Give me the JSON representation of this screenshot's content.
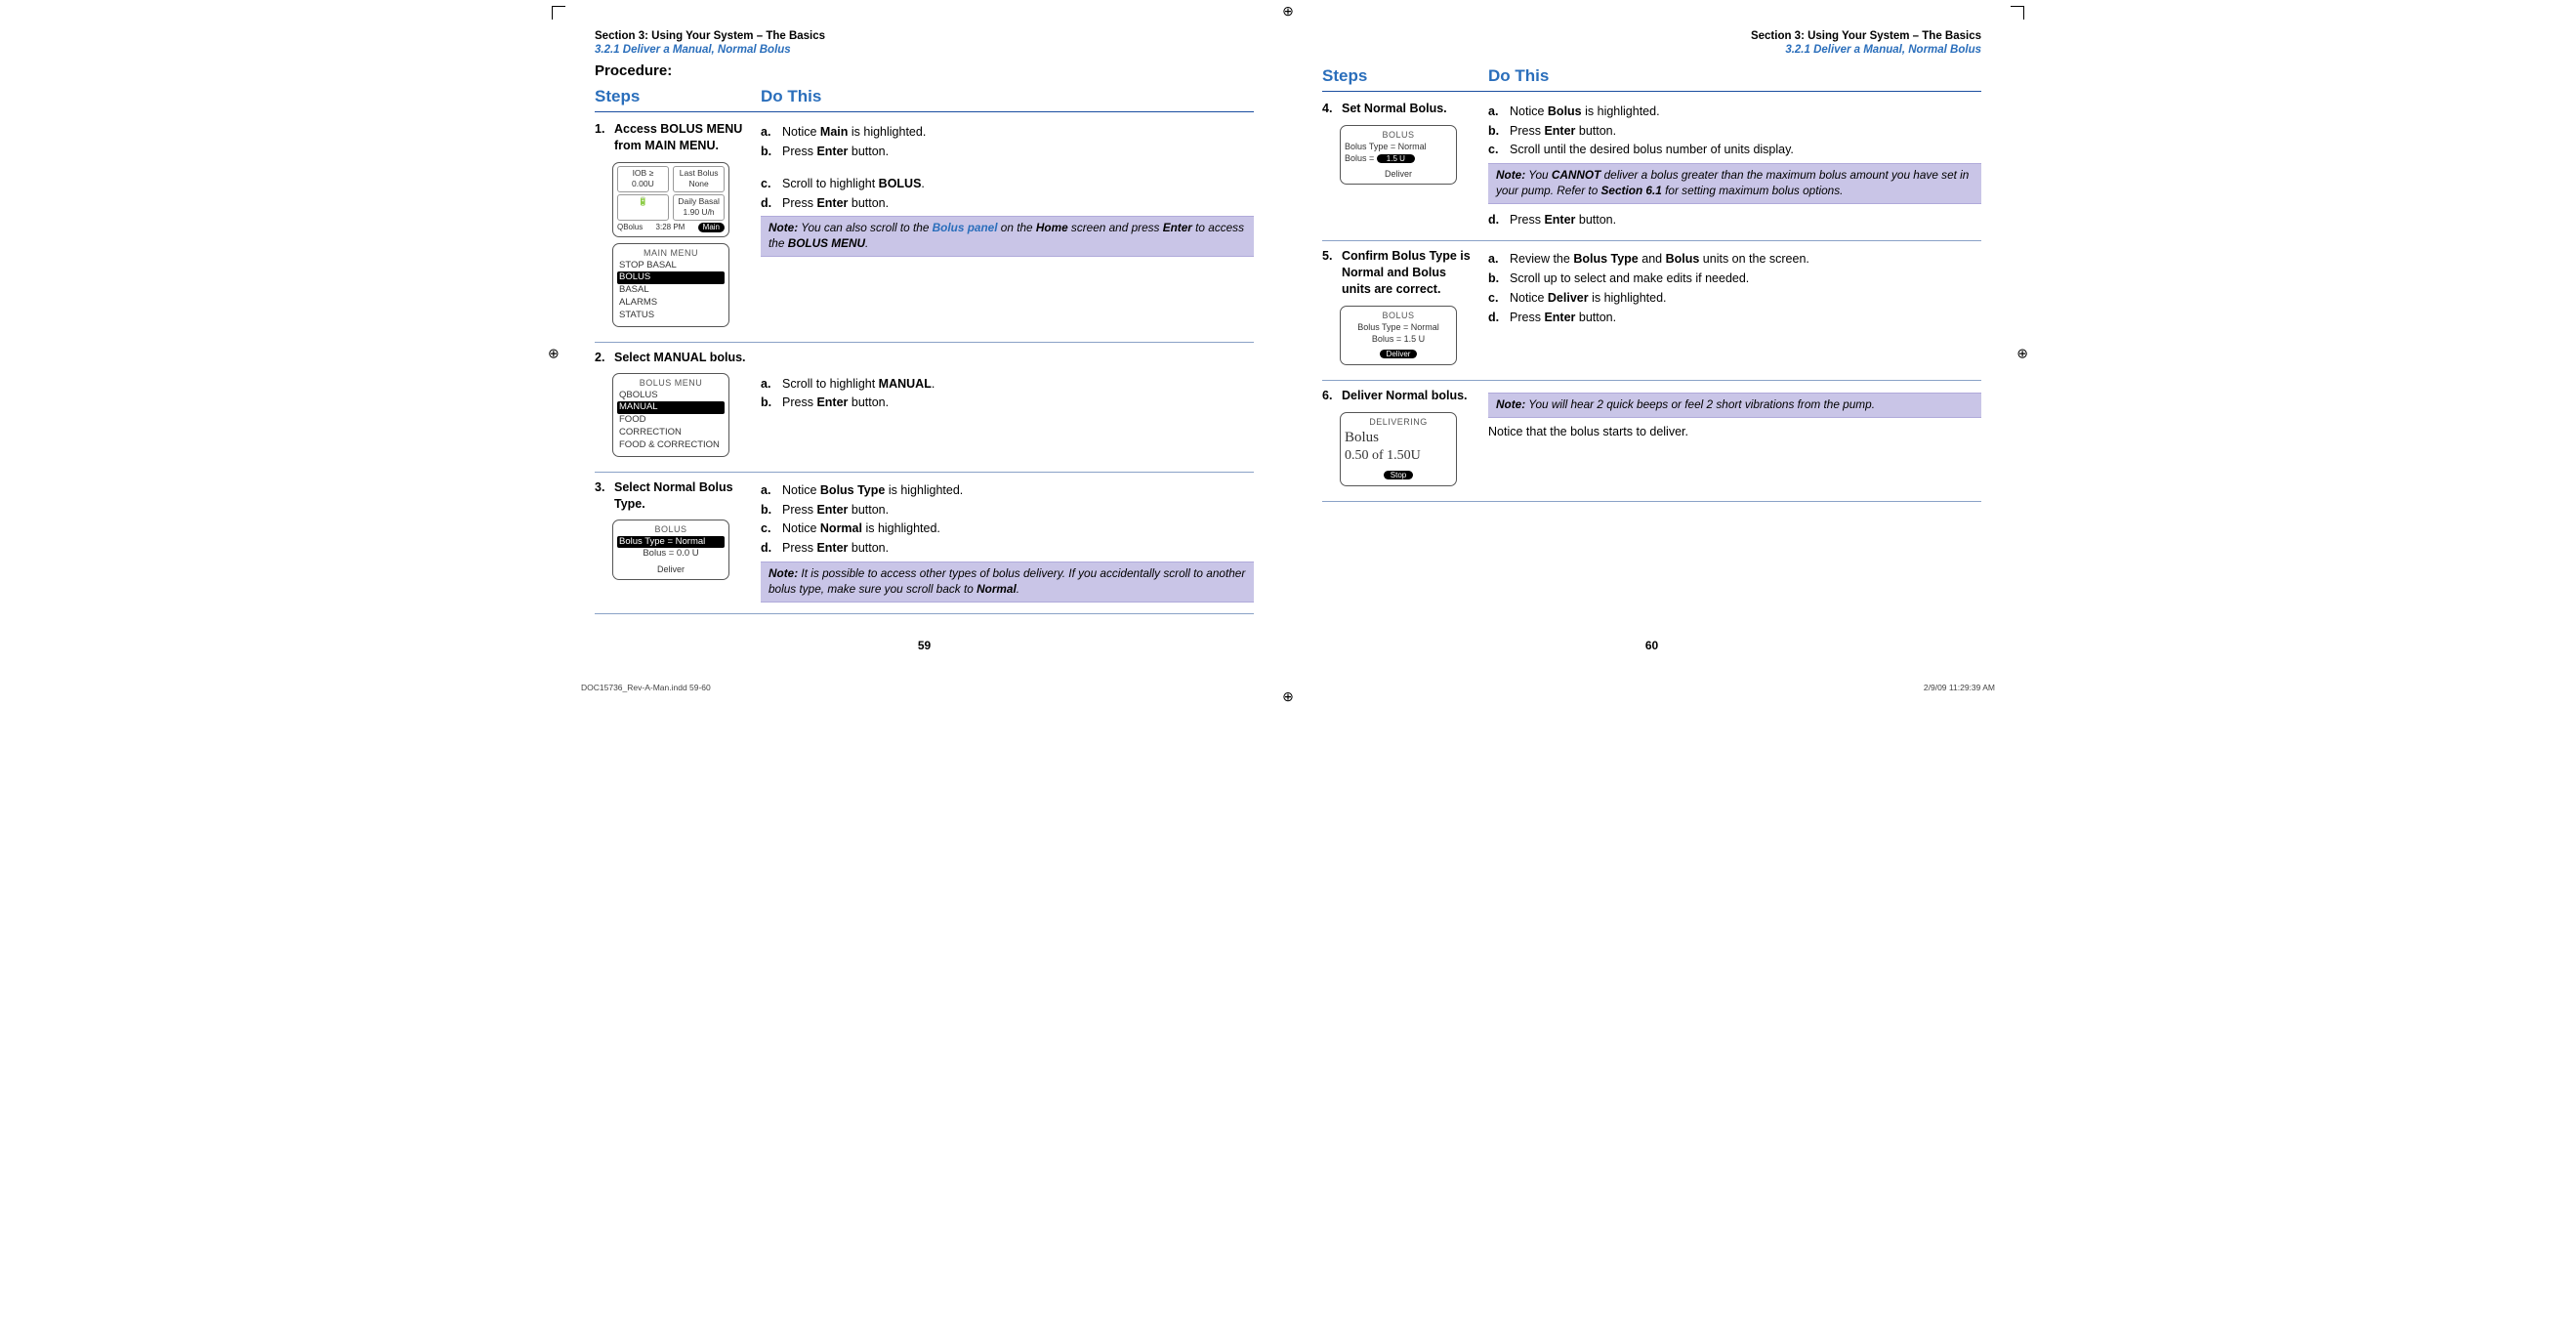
{
  "reg_mark": "⊕",
  "header": {
    "section_line": "Section 3: Using Your System – The Basics",
    "subsection_line": "3.2.1 Deliver a Manual, Normal Bolus"
  },
  "left_page": {
    "procedure_label": "Procedure:",
    "columns": {
      "steps": "Steps",
      "do_this": "Do This"
    },
    "steps": [
      {
        "num": "1.",
        "title_parts": [
          "Access ",
          "BOLUS MENU",
          " from ",
          "MAIN MENU",
          "."
        ],
        "screens": {
          "home": {
            "iob_label": "IOB ≥",
            "iob_value": "0.00U",
            "last_bolus_label": "Last Bolus",
            "last_bolus_value": "None",
            "batt": "🔋",
            "basal_label": "Daily Basal",
            "basal_value": "1.90 U/h",
            "foot_left": "QBolus",
            "foot_mid": "3:28 PM",
            "foot_right": "Main"
          },
          "main_menu": {
            "title": "MAIN MENU",
            "items": [
              "STOP BASAL",
              "BOLUS",
              "BASAL",
              "ALARMS",
              "STATUS"
            ],
            "selected_index": 1
          }
        },
        "subs": [
          {
            "lbl": "a.",
            "parts": [
              "Notice ",
              "Main",
              " is highlighted."
            ]
          },
          {
            "lbl": "b.",
            "parts": [
              "Press ",
              "Enter",
              " button."
            ]
          },
          {
            "lbl": "c.",
            "parts": [
              "Scroll to highlight ",
              "BOLUS",
              "."
            ]
          },
          {
            "lbl": "d.",
            "parts": [
              "Press ",
              "Enter",
              " button."
            ]
          }
        ],
        "note_parts": [
          "Note:",
          " You can also scroll to the ",
          "Bolus panel",
          " on the ",
          "Home",
          " screen and press ",
          "Enter",
          " to access the ",
          "BOLUS MENU",
          "."
        ]
      },
      {
        "num": "2.",
        "title_parts": [
          "Select ",
          "MANUAL",
          " bolus."
        ],
        "screens": {
          "bolus_menu": {
            "title": "BOLUS MENU",
            "items": [
              "QBOLUS",
              "MANUAL",
              "FOOD",
              "CORRECTION",
              "FOOD & CORRECTION"
            ],
            "selected_index": 1
          }
        },
        "subs": [
          {
            "lbl": "a.",
            "parts": [
              "Scroll to highlight ",
              "MANUAL",
              "."
            ]
          },
          {
            "lbl": "b.",
            "parts": [
              "Press ",
              "Enter",
              " button."
            ]
          }
        ]
      },
      {
        "num": "3.",
        "title_parts": [
          "Select Normal Bolus Type."
        ],
        "screens": {
          "bolus": {
            "title": "BOLUS",
            "line_sel": "Bolus Type = Normal",
            "line2": "Bolus = 0.0 U",
            "deliver": "Deliver"
          }
        },
        "subs": [
          {
            "lbl": "a.",
            "parts": [
              "Notice ",
              "Bolus Type",
              " is highlighted."
            ]
          },
          {
            "lbl": "b.",
            "parts": [
              "Press ",
              "Enter",
              " button."
            ]
          },
          {
            "lbl": "c.",
            "parts": [
              "Notice ",
              "Normal",
              " is highlighted."
            ]
          },
          {
            "lbl": "d.",
            "parts": [
              "Press ",
              "Enter",
              " button."
            ]
          }
        ],
        "note_parts": [
          "Note:",
          " It is possible to access other types of bolus delivery. If you accidentally scroll to another bolus type, make sure you scroll back to ",
          "Normal",
          "."
        ]
      }
    ],
    "folio": "59"
  },
  "right_page": {
    "columns": {
      "steps": "Steps",
      "do_this": "Do This"
    },
    "steps": [
      {
        "num": "4.",
        "title_parts": [
          "Set Normal Bolus."
        ],
        "screens": {
          "bolus": {
            "title": "BOLUS",
            "line1": "Bolus Type = Normal",
            "line2_label": "Bolus =",
            "line2_val_sel": "1.5 U",
            "deliver": "Deliver"
          }
        },
        "subs": [
          {
            "lbl": "a.",
            "parts": [
              "Notice ",
              "Bolus",
              " is highlighted."
            ]
          },
          {
            "lbl": "b.",
            "parts": [
              "Press ",
              "Enter",
              " button."
            ]
          },
          {
            "lbl": "c.",
            "parts": [
              "Scroll until the desired bolus number of units display."
            ]
          }
        ],
        "note_parts": [
          "Note:",
          " You ",
          "CANNOT",
          " deliver a bolus greater than the maximum bolus amount you have set in your pump. Refer to ",
          "Section 6.1",
          " for setting maximum bolus options."
        ],
        "subs_after": [
          {
            "lbl": "d.",
            "parts": [
              "Press ",
              "Enter",
              " button."
            ]
          }
        ]
      },
      {
        "num": "5.",
        "title_parts": [
          "Confirm Bolus Type is Normal and Bolus units are correct."
        ],
        "screens": {
          "bolus": {
            "title": "BOLUS",
            "line1": "Bolus Type = Normal",
            "line2": "Bolus = 1.5 U",
            "deliver_btn": "Deliver"
          }
        },
        "subs": [
          {
            "lbl": "a.",
            "parts": [
              "Review the ",
              "Bolus Type",
              " and ",
              "Bolus",
              " units on the screen."
            ]
          },
          {
            "lbl": "b.",
            "parts": [
              "Scroll up to select and make edits if needed."
            ]
          },
          {
            "lbl": "c.",
            "parts": [
              "Notice ",
              "Deliver",
              " is highlighted."
            ]
          },
          {
            "lbl": "d.",
            "parts": [
              "Press ",
              "Enter",
              " button."
            ]
          }
        ]
      },
      {
        "num": "6.",
        "title_parts": [
          "Deliver Normal bolus."
        ],
        "screens": {
          "delivering": {
            "title": "DELIVERING",
            "big1": "Bolus",
            "big2": "0.50 of 1.50U",
            "stop_btn": "Stop"
          }
        },
        "note_parts": [
          "Note:",
          " You will hear 2 quick beeps or feel 2 short vibrations from the pump."
        ],
        "plain_line": "Notice that the bolus starts to deliver."
      }
    ],
    "folio": "60"
  },
  "imprint": {
    "left": "DOC15736_Rev-A-Man.indd   59-60",
    "right": "2/9/09   11:29:39 AM"
  }
}
